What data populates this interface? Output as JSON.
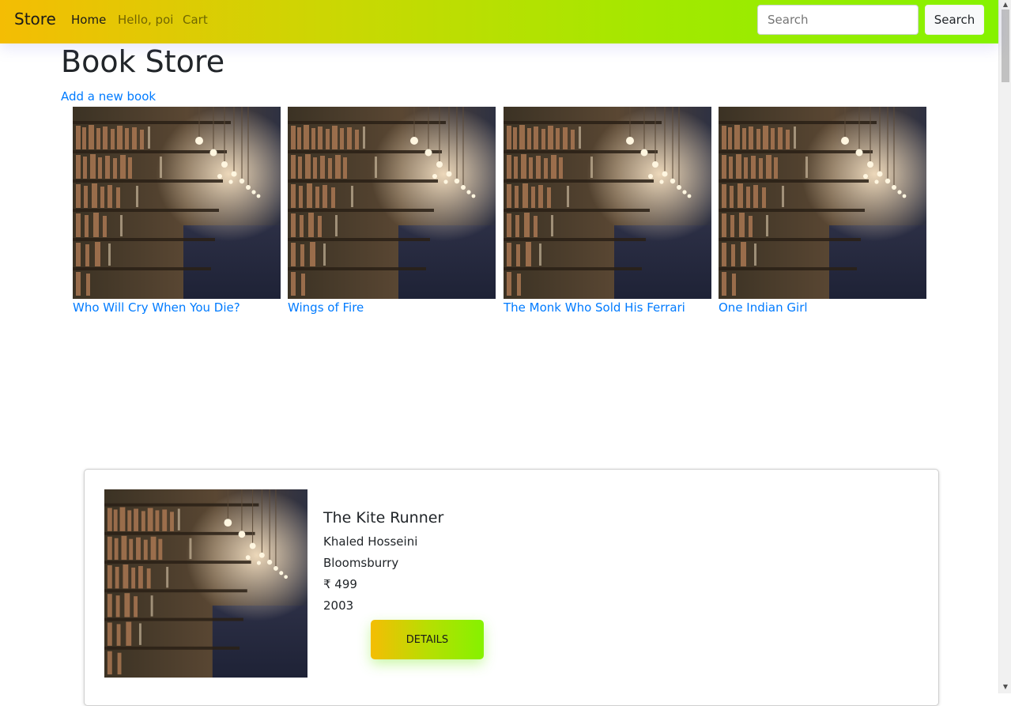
{
  "navbar": {
    "brand": "Store",
    "links": [
      {
        "label": "Home"
      },
      {
        "label": "Hello, poi"
      },
      {
        "label": "Cart"
      }
    ],
    "search": {
      "placeholder": "Search",
      "value": "",
      "button_label": "Search"
    },
    "gradient_colors": [
      "#f4bd04",
      "#85f200"
    ]
  },
  "page": {
    "title": "Book Store",
    "add_link": "Add a new book"
  },
  "books": [
    {
      "title": "Who Will Cry When You Die?",
      "image": "bookshelf-library-image"
    },
    {
      "title": "Wings of Fire",
      "image": "bookshelf-library-image"
    },
    {
      "title": "The Monk Who Sold His Ferrari",
      "image": "bookshelf-library-image"
    },
    {
      "title": "One Indian Girl",
      "image": "bookshelf-library-image"
    }
  ],
  "featured": {
    "title": "The Kite Runner",
    "author": "Khaled Hosseini",
    "publisher": "Bloomsburry",
    "price": "₹ 499",
    "year": "2003",
    "button_label": "DETAILS",
    "image": "bookshelf-library-image"
  },
  "colors": {
    "link": "#007bff",
    "text": "#212529"
  }
}
